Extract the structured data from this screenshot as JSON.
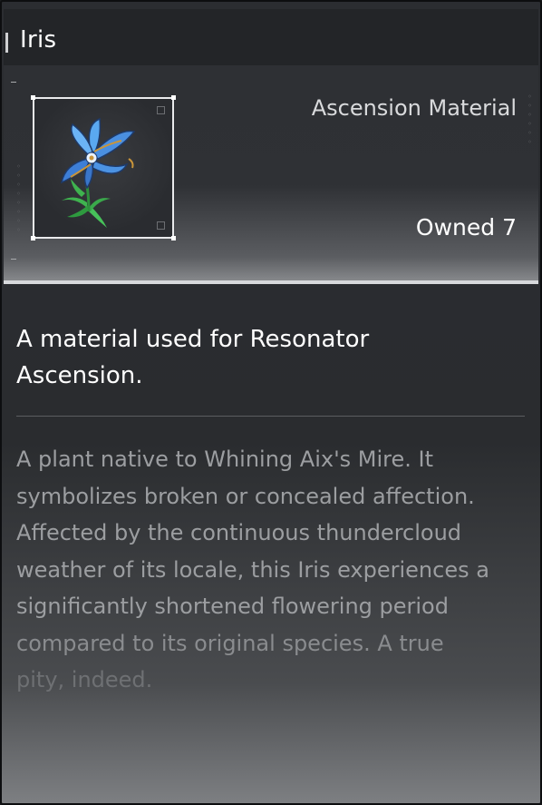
{
  "item": {
    "name": "Iris",
    "type": "Ascension Material",
    "owned": "Owned 7",
    "icon": "iris-flower-icon",
    "summary": [
      "A material used for Resonator",
      "Ascension."
    ],
    "description": [
      "A plant native to Whining Aix's Mire. It",
      "symbolizes broken or concealed affection.",
      "Affected by the continuous thundercloud",
      "weather of its locale, this Iris experiences a",
      "significantly shortened flowering period",
      "compared to its original species. A true",
      "pity, indeed."
    ]
  },
  "colors": {
    "panel_bg": "#2b2d31",
    "title_text": "#ffffff",
    "lore_text": "#9c9ea1",
    "petal": "#4a8fe0",
    "leaf": "#3fb34f"
  }
}
